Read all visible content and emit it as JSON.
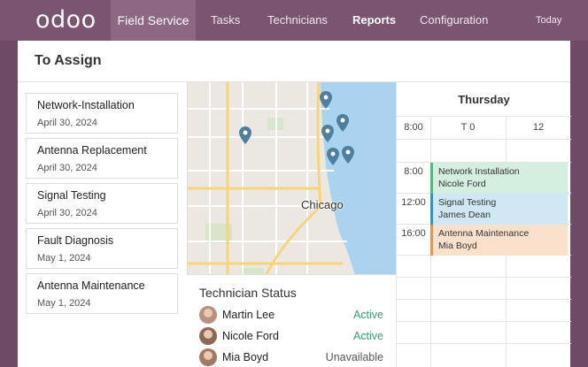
{
  "nav": {
    "logo": "odoo",
    "app": "Field Service",
    "items": [
      "Tasks",
      "Technicians",
      "Reports",
      "Configuration"
    ],
    "today": "Today"
  },
  "page": {
    "title": "To Assign"
  },
  "tasks": [
    {
      "name": "Network-Installation",
      "date": "April 30, 2024"
    },
    {
      "name": "Antenna Replacement",
      "date": "April 30, 2024"
    },
    {
      "name": "Signal Testing",
      "date": "April 30, 2024"
    },
    {
      "name": "Fault Diagnosis",
      "date": "May 1, 2024"
    },
    {
      "name": "Antenna Maintenance",
      "date": "May 1, 2024"
    }
  ],
  "map": {
    "city_label": "Chicago"
  },
  "technicians": {
    "title": "Technician Status",
    "rows": [
      {
        "name": "Martin Lee",
        "status": "Active",
        "status_color": "#3aa06a"
      },
      {
        "name": "Nicole Ford",
        "status": "Active",
        "status_color": "#3aa06a"
      },
      {
        "name": "Mia Boyd",
        "status": "Unavailable",
        "status_color": "#555555"
      }
    ]
  },
  "calendar": {
    "day": "Thursday",
    "header_times": [
      "8:00",
      "T 0",
      "12"
    ],
    "events": [
      {
        "time": "8:00",
        "title": "Network Installation",
        "who": "Nicole Ford",
        "color": "#d4efe0",
        "border": "#5ab384"
      },
      {
        "time": "12:00",
        "title": "Signal Testing",
        "who": "James Dean",
        "color": "#cfe8f3",
        "border": "#3f8fb7"
      },
      {
        "time": "16:00",
        "title": "Antenna Maintenance",
        "who": "Mia Boyd",
        "color": "#fbe1cc",
        "border": "#e0975d"
      }
    ]
  },
  "colors": {
    "brand": "#7a5470",
    "pin": "#4f7f9f",
    "water": "#a9d3ef"
  }
}
